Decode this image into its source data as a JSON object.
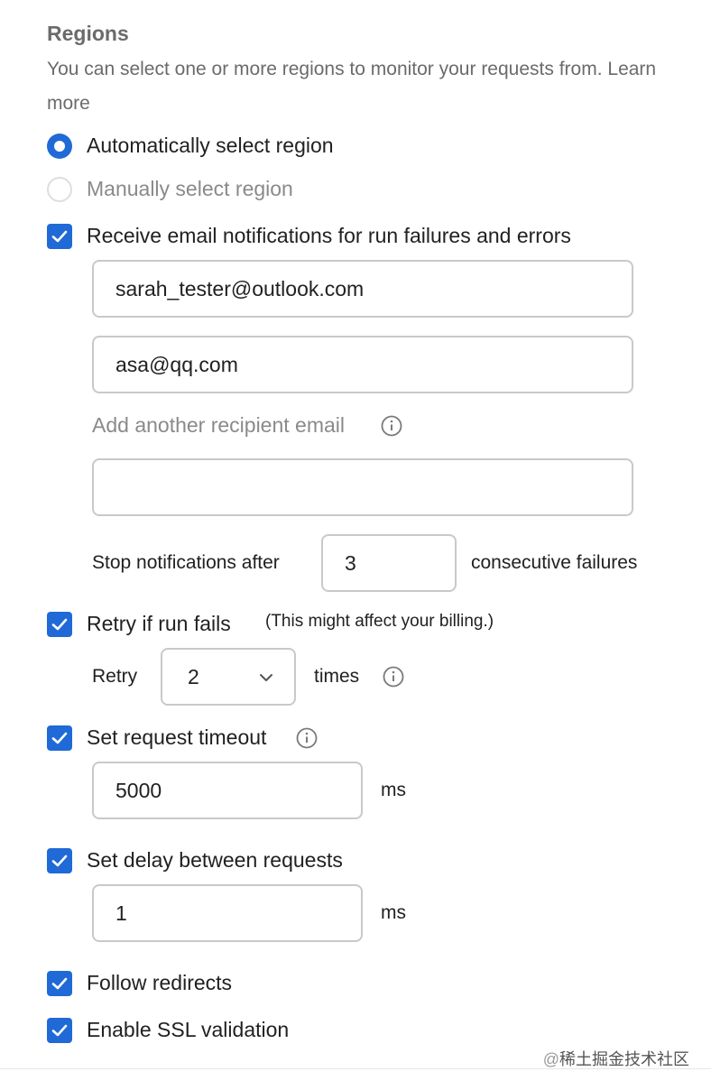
{
  "regions": {
    "title": "Regions",
    "description": "You can select one or more regions to monitor your requests from.",
    "learn_more": "Learn more",
    "options": [
      {
        "label": "Automatically select region",
        "selected": true
      },
      {
        "label": "Manually select region",
        "selected": false
      }
    ]
  },
  "email_notifications": {
    "label": "Receive email notifications for run failures and errors",
    "checked": true,
    "recipients": [
      "sarah_tester@outlook.com",
      "asa@qq.com"
    ],
    "add_label": "Add another recipient email",
    "new_recipient_value": "",
    "stop_prefix": "Stop notifications after",
    "stop_value": "3",
    "stop_suffix": "consecutive failures"
  },
  "retry": {
    "label": "Retry if run fails",
    "checked": true,
    "note": "(This might affect your billing.)",
    "prefix": "Retry",
    "value": "2",
    "suffix": "times"
  },
  "timeout": {
    "label": "Set request timeout",
    "checked": true,
    "value": "5000",
    "unit": "ms"
  },
  "delay": {
    "label": "Set delay between requests",
    "checked": true,
    "value": "1",
    "unit": "ms"
  },
  "follow_redirects": {
    "label": "Follow redirects",
    "checked": true
  },
  "ssl_validation": {
    "label": "Enable SSL validation",
    "checked": true
  },
  "watermark": {
    "handle": "@",
    "text": "稀土掘金技术社区"
  },
  "colors": {
    "accent": "#1f6ad6",
    "border": "#c9c9c9",
    "muted_text": "#6b6b6b"
  },
  "icons": [
    "check-icon",
    "info-icon",
    "chevron-down-icon"
  ]
}
